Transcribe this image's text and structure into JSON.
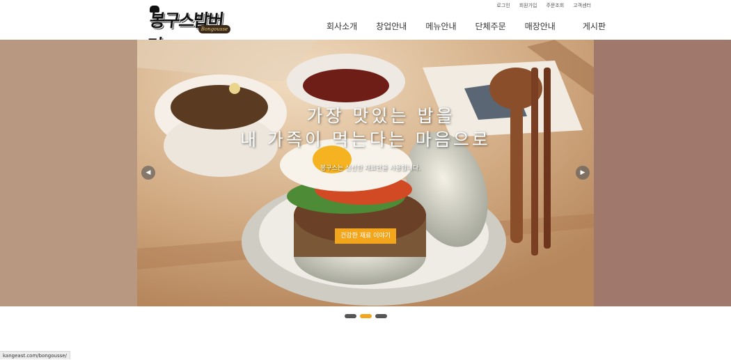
{
  "brand": {
    "logo_text": "봉구스밥버거",
    "logo_tagline": "Bongousse"
  },
  "util_nav": [
    "로그인",
    "회원가입",
    "주문조회",
    "고객센터"
  ],
  "main_nav": [
    "회사소개",
    "창업안내",
    "메뉴안내",
    "단체주문",
    "매장안내",
    "게시판"
  ],
  "hero": {
    "title_line1": "가장 맛있는 밥을",
    "title_line2": "내 가족이 먹는다는 마음으로",
    "subtitle": "봉구스는 신선한 재료만을 사용합니다.",
    "cta_label": "건강한 재료 이야기",
    "prev_glyph": "◀",
    "next_glyph": "▶",
    "slide_count": 3,
    "active_slide": 2
  },
  "status_bar": {
    "url": "kangeast.com/bongousse/"
  },
  "colors": {
    "accent": "#f3a51c",
    "side_left": "#b99882",
    "side_right": "#a1786c",
    "dot_inactive": "#555555"
  }
}
